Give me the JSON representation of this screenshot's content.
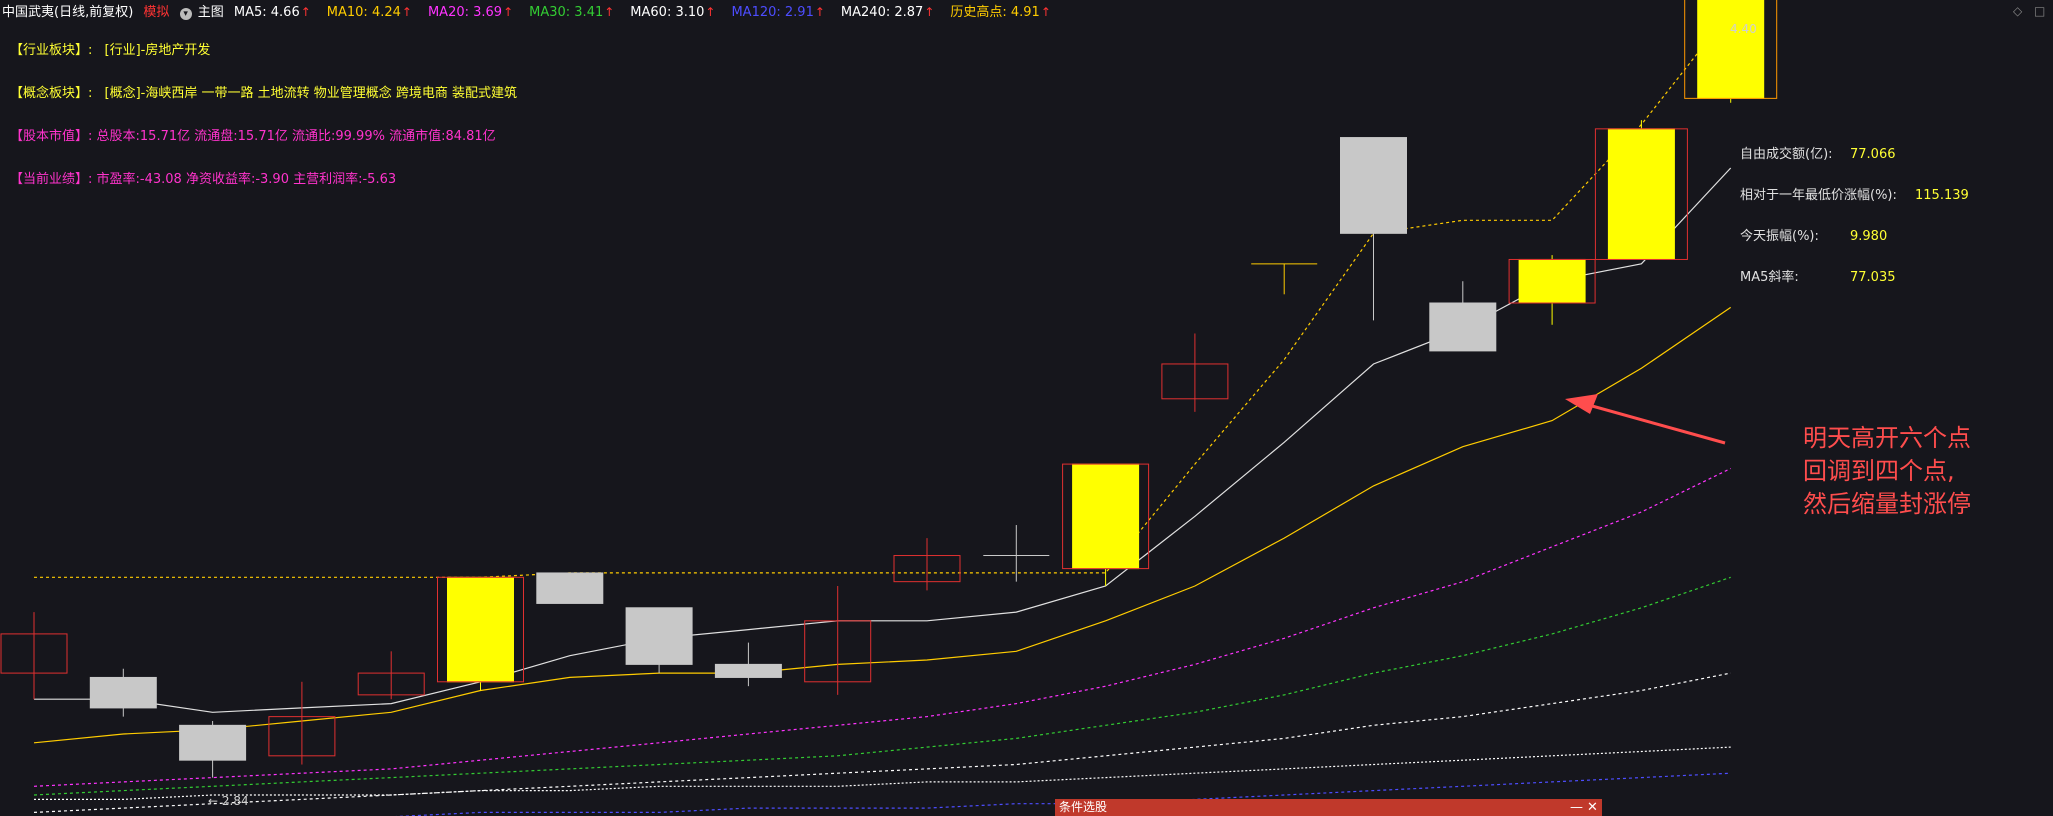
{
  "topbar": {
    "stock_title": "中国武夷(日线,前复权)",
    "mode": "模拟",
    "main_chart": "主图",
    "indicators": [
      {
        "label": "MA5: 4.66",
        "color": "#ffffff"
      },
      {
        "label": "MA10: 4.24",
        "color": "#ffcc00"
      },
      {
        "label": "MA20: 3.69",
        "color": "#ff33ff"
      },
      {
        "label": "MA30: 3.41",
        "color": "#33cc33"
      },
      {
        "label": "MA60: 3.10",
        "color": "#ffffff"
      },
      {
        "label": "MA120: 2.91",
        "color": "#4d4dff"
      },
      {
        "label": "MA240: 2.87",
        "color": "#ffffff"
      },
      {
        "label": "历史高点: 4.91",
        "color": "#ffcc00"
      }
    ],
    "arrow": "↑",
    "arrow_color": "#ff3333"
  },
  "info": {
    "industry": {
      "label": "【行业板块】:",
      "value": "[行业]-房地产开发",
      "color": "#ffff33"
    },
    "concept": {
      "label": "【概念板块】:",
      "value": "[概念]-海峡西岸 一带一路 土地流转 物业管理概念 跨境电商 装配式建筑",
      "color": "#ffff33"
    },
    "equity": {
      "label": "【股本市值】:",
      "value": "总股本:15.71亿   流通盘:15.71亿   流通比:99.99%   流通市值:84.81亿",
      "color": "#ff33cc"
    },
    "performance": {
      "label": "【当前业绩】:",
      "value": "市盈率:-43.08   净资收益率:-3.90   主营利润率:-5.63",
      "color": "#ff33cc"
    }
  },
  "stats": [
    {
      "label": "自由成交额(亿):",
      "value": "77.066"
    },
    {
      "label": "相对于一年最低价涨幅(%):",
      "value": "115.139"
    },
    {
      "label": "今天振幅(%):",
      "value": "9.980"
    },
    {
      "label": "MA5斜率:",
      "value": "77.035"
    }
  ],
  "annotation": {
    "lines": [
      "明天高开六个点",
      "回调到四个点,",
      "然后缩量封涨停"
    ],
    "color": "#ff4d4d"
  },
  "chart_labels": {
    "low_marker": "← 2.84",
    "high_marker": "4.40"
  },
  "bottom_panel": {
    "title": "条件选股",
    "minimize": "—",
    "close": "✕"
  },
  "corner": {
    "left": "◇",
    "right": "□"
  },
  "chart_data": {
    "type": "candlestick",
    "ylim": [
      2.8,
      4.58
    ],
    "candles": [
      {
        "open": 3.17,
        "close": 3.08,
        "high": 3.22,
        "low": 3.02,
        "style": "red"
      },
      {
        "open": 3.07,
        "close": 3.0,
        "high": 3.09,
        "low": 2.98,
        "style": "gray"
      },
      {
        "open": 2.96,
        "close": 2.88,
        "high": 2.97,
        "low": 2.84,
        "style": "gray"
      },
      {
        "open": 2.89,
        "close": 2.98,
        "high": 3.06,
        "low": 2.87,
        "style": "red"
      },
      {
        "open": 3.03,
        "close": 3.08,
        "high": 3.13,
        "low": 3.02,
        "style": "red"
      },
      {
        "open": 3.06,
        "close": 3.3,
        "high": 3.3,
        "low": 3.04,
        "style": "yellow"
      },
      {
        "open": 3.24,
        "close": 3.31,
        "high": 3.31,
        "low": 3.24,
        "style": "gray"
      },
      {
        "open": 3.1,
        "close": 3.23,
        "high": 3.23,
        "low": 3.08,
        "style": "gray"
      },
      {
        "open": 3.07,
        "close": 3.1,
        "high": 3.15,
        "low": 3.05,
        "style": "gray"
      },
      {
        "open": 3.2,
        "close": 3.06,
        "high": 3.28,
        "low": 3.03,
        "style": "red"
      },
      {
        "open": 3.29,
        "close": 3.35,
        "high": 3.39,
        "low": 3.27,
        "style": "red"
      },
      {
        "open": 3.35,
        "close": 3.35,
        "high": 3.42,
        "low": 3.29,
        "style": "doji"
      },
      {
        "open": 3.32,
        "close": 3.56,
        "high": 3.56,
        "low": 3.28,
        "style": "yellow"
      },
      {
        "open": 3.71,
        "close": 3.79,
        "high": 3.86,
        "low": 3.68,
        "style": "red"
      },
      {
        "open": 4.02,
        "close": 4.02,
        "high": 4.02,
        "low": 3.95,
        "style": "tline"
      },
      {
        "open": 4.09,
        "close": 4.31,
        "high": 4.31,
        "low": 3.89,
        "style": "gray"
      },
      {
        "open": 3.82,
        "close": 3.93,
        "high": 3.98,
        "low": 3.82,
        "style": "gray"
      },
      {
        "open": 3.93,
        "close": 4.03,
        "high": 4.04,
        "low": 3.88,
        "style": "yellow"
      },
      {
        "open": 4.03,
        "close": 4.33,
        "high": 4.35,
        "low": 4.03,
        "style": "yellow"
      },
      {
        "open": 4.4,
        "close": 4.69,
        "high": 4.69,
        "low": 4.39,
        "style": "yellow"
      }
    ],
    "ma_lines": [
      {
        "name": "MA5",
        "color": "#e0e0e0",
        "dash": "",
        "values": [
          3.02,
          3.02,
          2.99,
          3.0,
          3.01,
          3.06,
          3.12,
          3.16,
          3.18,
          3.2,
          3.2,
          3.22,
          3.28,
          3.44,
          3.61,
          3.79,
          3.87,
          3.98,
          4.02,
          4.24
        ]
      },
      {
        "name": "MA10",
        "color": "#ffcc00",
        "dash": "",
        "values": [
          2.92,
          2.94,
          2.95,
          2.97,
          2.99,
          3.04,
          3.07,
          3.08,
          3.08,
          3.1,
          3.11,
          3.13,
          3.2,
          3.28,
          3.39,
          3.51,
          3.6,
          3.66,
          3.78,
          3.92
        ]
      },
      {
        "name": "MA20",
        "color": "#ff33ff",
        "dash": "3,3",
        "values": [
          2.82,
          2.83,
          2.84,
          2.85,
          2.86,
          2.88,
          2.9,
          2.92,
          2.94,
          2.96,
          2.98,
          3.01,
          3.05,
          3.1,
          3.16,
          3.23,
          3.29,
          3.37,
          3.45,
          3.55
        ]
      },
      {
        "name": "MA30",
        "color": "#33cc33",
        "dash": "3,3",
        "values": [
          2.8,
          2.81,
          2.82,
          2.83,
          2.84,
          2.85,
          2.86,
          2.87,
          2.88,
          2.89,
          2.91,
          2.93,
          2.96,
          2.99,
          3.03,
          3.08,
          3.12,
          3.17,
          3.23,
          3.3
        ]
      },
      {
        "name": "MA60",
        "color": "#ffffff",
        "dash": "3,3",
        "values": [
          2.76,
          2.77,
          2.78,
          2.79,
          2.8,
          2.81,
          2.82,
          2.83,
          2.84,
          2.85,
          2.86,
          2.87,
          2.89,
          2.91,
          2.93,
          2.96,
          2.98,
          3.01,
          3.04,
          3.08
        ]
      },
      {
        "name": "MA240",
        "color": "#ffffff",
        "dash": "2,2",
        "values": [
          2.79,
          2.79,
          2.8,
          2.8,
          2.8,
          2.81,
          2.81,
          2.82,
          2.82,
          2.82,
          2.83,
          2.83,
          2.84,
          2.85,
          2.86,
          2.87,
          2.88,
          2.89,
          2.9,
          2.91
        ]
      },
      {
        "name": "MA120",
        "color": "#4d4dff",
        "dash": "3,3",
        "values": [
          2.74,
          2.74,
          2.75,
          2.75,
          2.75,
          2.76,
          2.76,
          2.76,
          2.77,
          2.77,
          2.77,
          2.78,
          2.78,
          2.79,
          2.8,
          2.81,
          2.82,
          2.83,
          2.84,
          2.85
        ]
      },
      {
        "name": "历史高点",
        "color": "#ffcc00",
        "dash": "3,3",
        "values": [
          3.3,
          3.3,
          3.3,
          3.3,
          3.3,
          3.3,
          3.31,
          3.31,
          3.31,
          3.31,
          3.31,
          3.31,
          3.31,
          3.56,
          3.8,
          4.09,
          4.12,
          4.12,
          4.34,
          4.6
        ]
      }
    ]
  }
}
